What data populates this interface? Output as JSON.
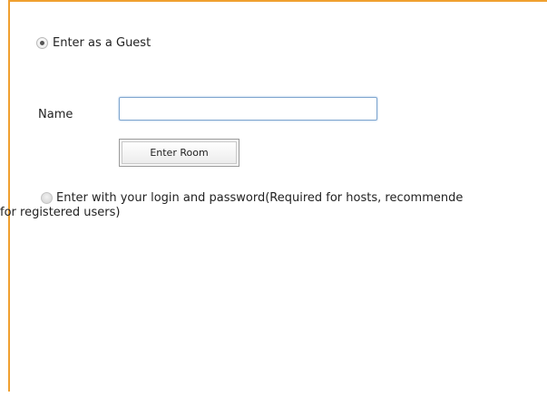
{
  "guest_option": {
    "label": "Enter as a Guest",
    "selected": true
  },
  "name_field": {
    "label": "Name",
    "value": "",
    "placeholder": ""
  },
  "enter_room_button": {
    "label": "Enter Room"
  },
  "login_option": {
    "label_line1": "Enter with your login and password(Required for hosts, recommende",
    "label_line2": "for registered users)",
    "selected": false
  },
  "colors": {
    "panel_border": "#f0a030",
    "input_border": "#7fa6cf"
  }
}
